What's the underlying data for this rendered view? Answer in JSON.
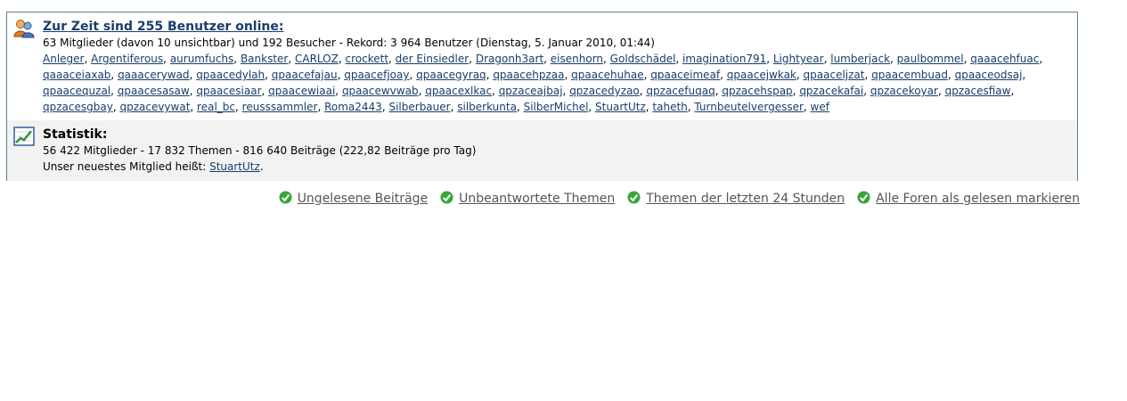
{
  "online": {
    "title": "Zur Zeit sind 255 Benutzer online:",
    "summary": "63 Mitglieder (davon 10 unsichtbar) und 192 Besucher - Rekord: 3 964 Benutzer (Dienstag, 5. Januar 2010, 01:44)",
    "users": [
      "Anleger",
      "Argentiferous",
      "aurumfuchs",
      "Bankster",
      "CARLOZ",
      "crockett",
      "der Einsiedler",
      "Dragonh3art",
      "eisenhorn",
      "Goldschädel",
      "imagination791",
      "Lightyear",
      "lumberjack",
      "paulbommel",
      "qaaacehfuac",
      "qaaaceiaxab",
      "qaaacerywad",
      "qpaacedylah",
      "qpaacefajau",
      "qpaacefjoay",
      "qpaacegyraq",
      "qpaacehpzaa",
      "qpaacehuhae",
      "qpaaceimeaf",
      "qpaacejwkak",
      "qpaaceljzat",
      "qpaacembuad",
      "qpaaceodsaj",
      "qpaacequzal",
      "qpaacesasaw",
      "qpaacesiaar",
      "qpaacewiaai",
      "qpaacewvwab",
      "qpaacexlkac",
      "qpzaceajbaj",
      "qpzacedyzao",
      "qpzacefuqaq",
      "qpzacehspap",
      "qpzacekafai",
      "qpzacekoyar",
      "qpzacesfiaw",
      "qpzacesgbay",
      "qpzacevywat",
      "real_bc",
      "reusssammler",
      "Roma2443",
      "Silberbauer",
      "silberkunta",
      "SilberMichel",
      "StuartUtz",
      "taheth",
      "Turnbeutelvergesser",
      "wef"
    ]
  },
  "stats": {
    "title": "Statistik:",
    "line1": "56 422 Mitglieder - 17 832 Themen - 816 640 Beiträge (222,82 Beiträge pro Tag)",
    "newest_prefix": "Unser neuestes Mitglied heißt: ",
    "newest_member": "StuartUtz",
    "newest_suffix": "."
  },
  "quicklinks": {
    "unread": "Ungelesene Beiträge",
    "unanswered": "Unbeantwortete Themen",
    "last24": "Themen der letzten 24 Stunden",
    "mark_read": "Alle Foren als gelesen markieren"
  },
  "colors": {
    "link": "#1a3d6b",
    "border": "#5b7f8f",
    "stats_bg": "#f2f2f2",
    "check_green": "#3aa53a"
  },
  "icons": {
    "online": "users-online-icon",
    "stats": "statistics-chart-icon",
    "check": "green-check-icon"
  }
}
